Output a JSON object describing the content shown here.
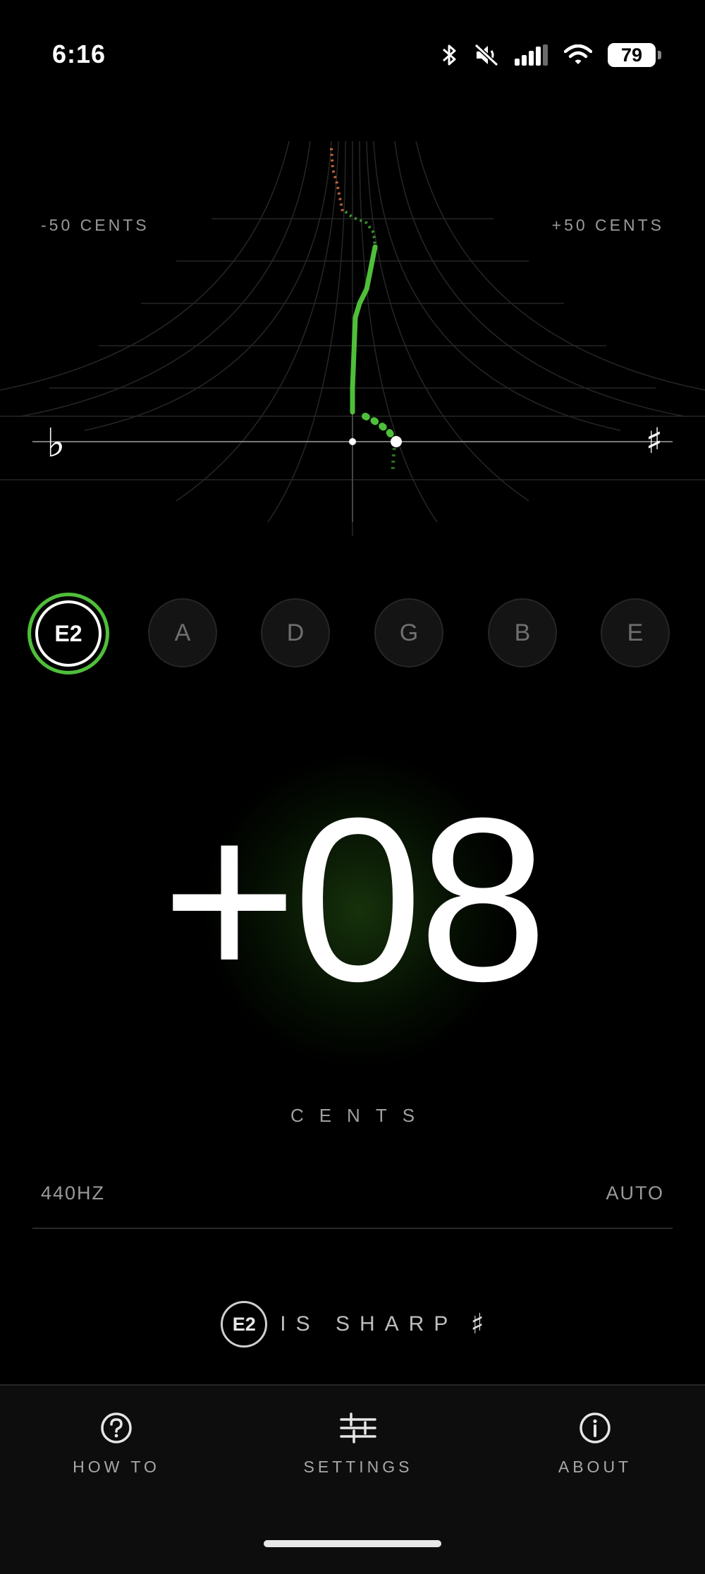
{
  "status": {
    "time": "6:16",
    "battery": "79"
  },
  "graph": {
    "left_label": "-50 CENTS",
    "right_label": "+50 CENTS",
    "flat_symbol": "♭",
    "sharp_symbol": "♯"
  },
  "strings": [
    {
      "label": "E2",
      "active": true
    },
    {
      "label": "A",
      "active": false
    },
    {
      "label": "D",
      "active": false
    },
    {
      "label": "G",
      "active": false
    },
    {
      "label": "B",
      "active": false
    },
    {
      "label": "E",
      "active": false
    }
  ],
  "readout": {
    "value": "+08",
    "unit": "CENTS"
  },
  "reference": {
    "frequency": "440HZ",
    "mode": "AUTO"
  },
  "message": {
    "note": "E2",
    "text": "IS SHARP",
    "symbol": "♯"
  },
  "tabs": [
    {
      "label": "HOW TO",
      "icon": "question-circle-icon"
    },
    {
      "label": "SETTINGS",
      "icon": "sliders-icon"
    },
    {
      "label": "ABOUT",
      "icon": "info-circle-icon"
    }
  ],
  "colors": {
    "accent": "#4fbf3a",
    "orange_trace": "#b8603a"
  }
}
